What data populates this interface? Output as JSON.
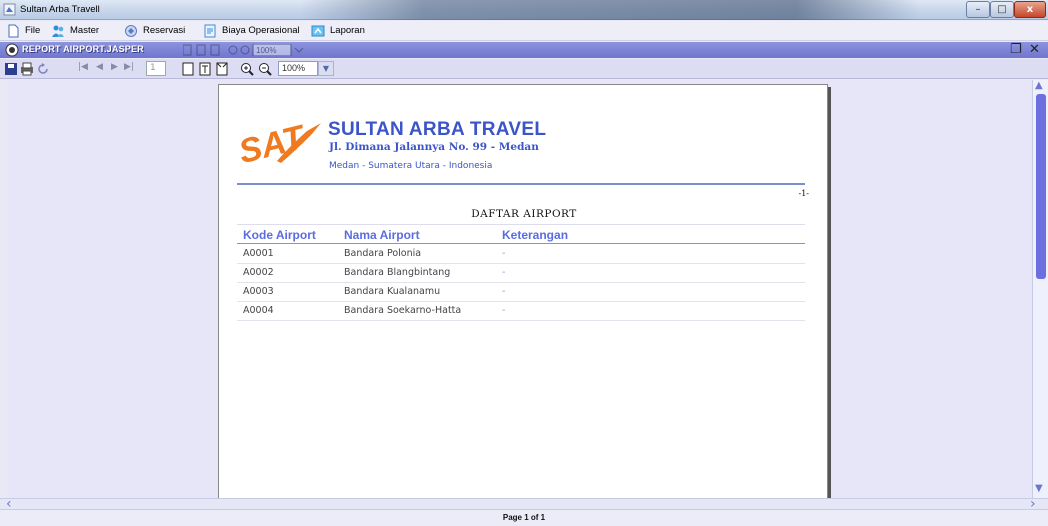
{
  "window": {
    "title": "Sultan Arba Travell"
  },
  "menu": [
    {
      "label": "File",
      "icon": "file-icon"
    },
    {
      "label": "Master",
      "icon": "users-icon"
    },
    {
      "label": "Reservasi",
      "icon": "reservation-icon"
    },
    {
      "label": "Biaya Operasional",
      "icon": "document-icon"
    },
    {
      "label": "Laporan",
      "icon": "report-icon"
    }
  ],
  "internal_frame": {
    "title": "REPORT AIRPORT.JASPER"
  },
  "toolbar": {
    "page_value": "1",
    "zoom_value": "100%",
    "ghost_zoom": "100%"
  },
  "report": {
    "company_name": "SULTAN ARBA TRAVEL",
    "address": "Jl. Dimana Jalannya No. 99 - Medan",
    "city": "Medan - Sumatera Utara - Indonesia",
    "logo_text": "SAT",
    "page_number": "-1-",
    "title": "DAFTAR AIRPORT",
    "columns": [
      "Kode Airport",
      "Nama Airport",
      "Keterangan"
    ],
    "rows": [
      {
        "kode": "A0001",
        "nama": "Bandara Polonia",
        "ket": "-"
      },
      {
        "kode": "A0002",
        "nama": "Bandara Blangbintang",
        "ket": "-"
      },
      {
        "kode": "A0003",
        "nama": "Bandara Kualanamu",
        "ket": "-"
      },
      {
        "kode": "A0004",
        "nama": "Bandara Soekarno-Hatta",
        "ket": "-"
      }
    ]
  },
  "status": {
    "page_info": "Page 1 of 1"
  },
  "colors": {
    "accent": "#3b55c9",
    "frame_title": "#7a80d8",
    "logo_orange": "#f07a1f"
  }
}
